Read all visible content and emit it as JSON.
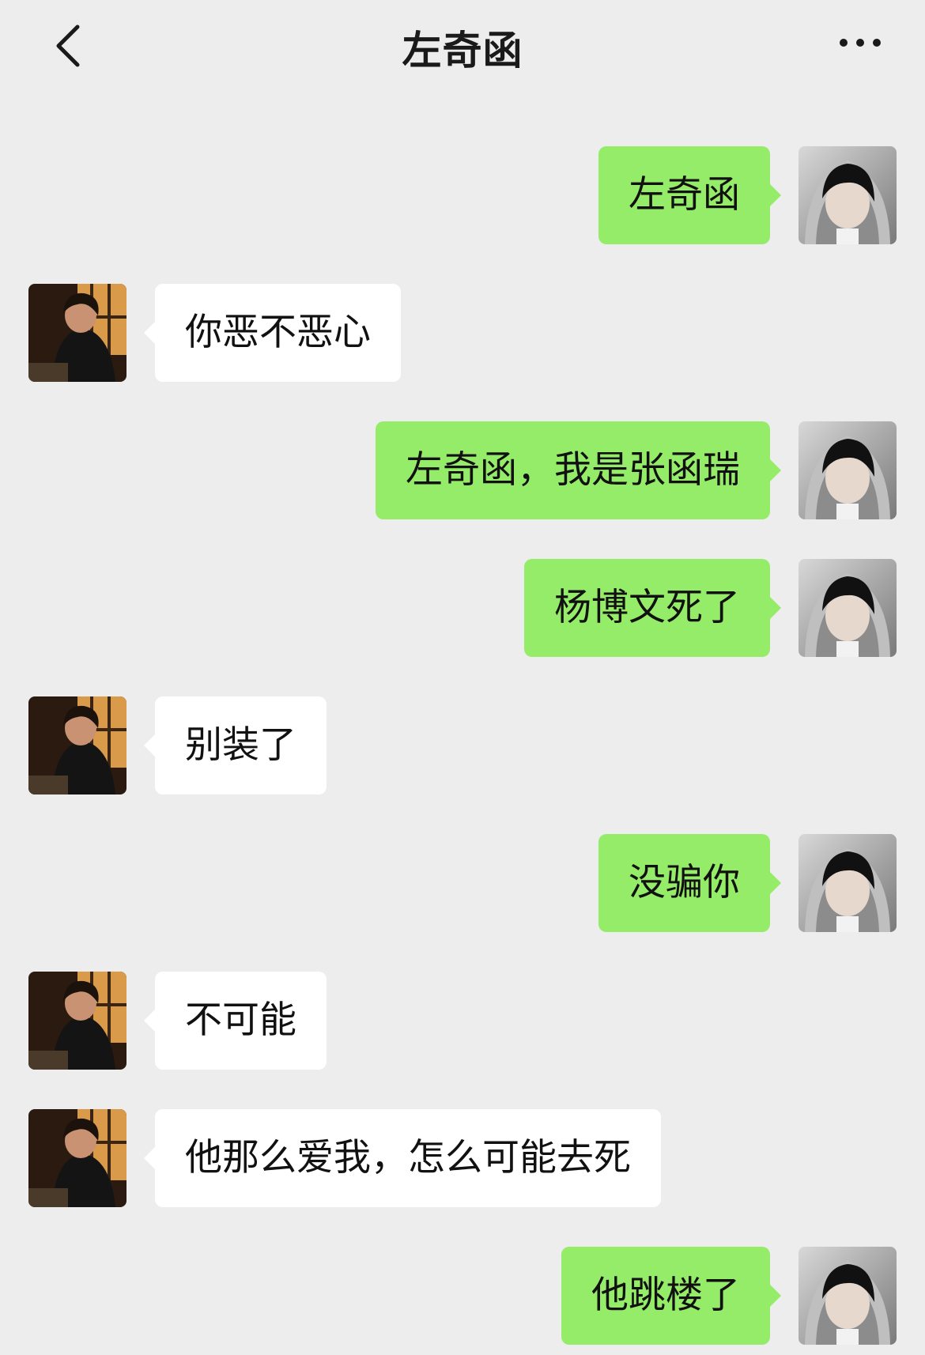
{
  "header": {
    "title": "左奇函",
    "back_icon": "chevron-left-icon",
    "more_icon": "more-dots-icon"
  },
  "colors": {
    "background": "#ededed",
    "sent_bubble": "#95ec69",
    "received_bubble": "#ffffff"
  },
  "messages": [
    {
      "direction": "sent",
      "text": "左奇函"
    },
    {
      "direction": "received",
      "text": "你恶不恶心"
    },
    {
      "direction": "sent",
      "text": "左奇函，我是张函瑞"
    },
    {
      "direction": "sent",
      "text": "杨博文死了"
    },
    {
      "direction": "received",
      "text": "别装了"
    },
    {
      "direction": "sent",
      "text": "没骗你"
    },
    {
      "direction": "received",
      "text": "不可能"
    },
    {
      "direction": "received",
      "text": "他那么爱我，怎么可能去死"
    },
    {
      "direction": "sent",
      "text": "他跳楼了"
    }
  ]
}
